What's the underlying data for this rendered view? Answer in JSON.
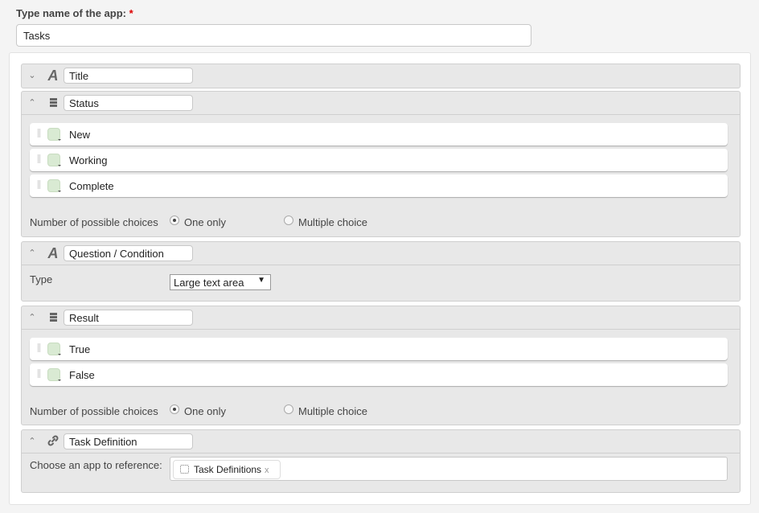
{
  "app_name": {
    "label": "Type name of the app:",
    "required_mark": "*",
    "value": "Tasks"
  },
  "fields": [
    {
      "name": "Title",
      "type_icon": "text-icon",
      "expanded": false
    },
    {
      "name": "Status",
      "type_icon": "category-icon",
      "expanded": true,
      "choices": [
        "New",
        "Working",
        "Complete"
      ],
      "choice_count_label": "Number of possible choices",
      "options": [
        "One only",
        "Multiple choice"
      ],
      "selected_option": "One only"
    },
    {
      "name": "Question / Condition",
      "type_icon": "text-icon",
      "expanded": true,
      "type_label": "Type",
      "type_value": "Large text area"
    },
    {
      "name": "Result",
      "type_icon": "category-icon",
      "expanded": true,
      "choices": [
        "True",
        "False"
      ],
      "choice_count_label": "Number of possible choices",
      "options": [
        "One only",
        "Multiple choice"
      ],
      "selected_option": "One only"
    },
    {
      "name": "Task Definition",
      "type_icon": "link-icon",
      "expanded": true,
      "reference_label": "Choose an app to reference:",
      "referenced_app": "Task Definitions",
      "remove_label": "x"
    }
  ],
  "colors": {
    "choice_color": "#d9ead3",
    "required": "#dd0000"
  },
  "icons": {
    "expanded": "▲",
    "collapsed": "▼",
    "text": "A",
    "select_arrow": "▼"
  }
}
